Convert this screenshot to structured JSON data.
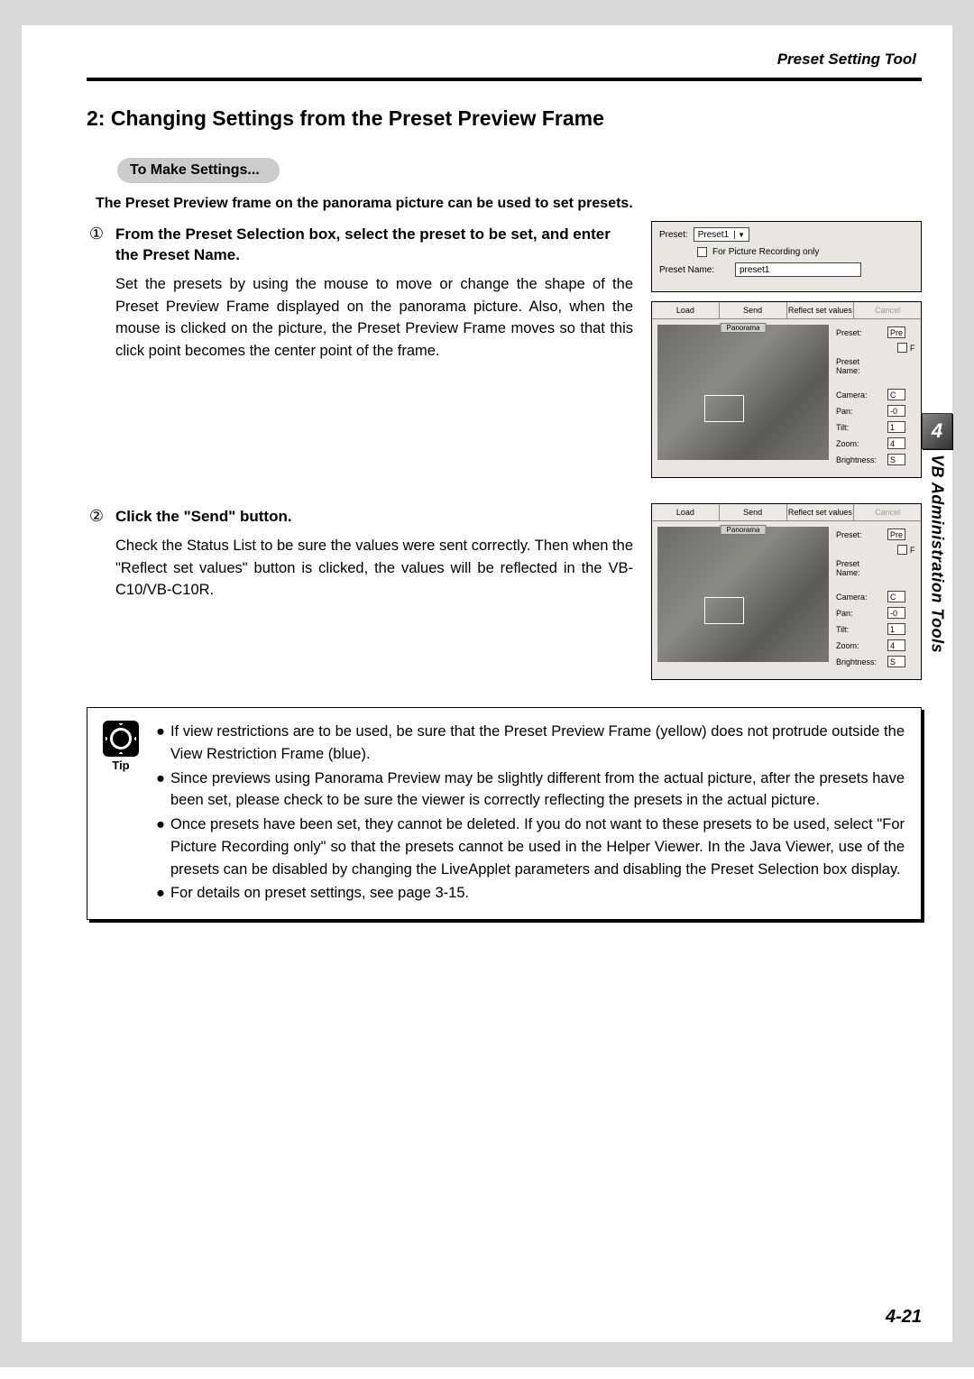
{
  "header": {
    "tool_title": "Preset Setting Tool"
  },
  "section": {
    "title": "2: Changing Settings from the Preset Preview Frame",
    "pill": "To Make Settings...",
    "lead": "The Preset Preview frame on the panorama picture can be used to set presets."
  },
  "step1": {
    "num": "①",
    "title": "From the Preset Selection box, select the preset to be set, and enter the Preset Name.",
    "body": "Set the presets by using the mouse to move or change the shape of the Preset Preview Frame displayed on the panorama picture. Also, when the mouse is clicked on the picture, the Preset Preview Frame moves so that this click point becomes the center point of the frame."
  },
  "step2": {
    "num": "②",
    "title": "Click the \"Send\" button.",
    "body": "Check the Status List to be sure the values were sent correctly. Then when the \"Reflect set values\" button is clicked, the values will be reflected in the VB-C10/VB-C10R."
  },
  "shot_top": {
    "preset_label": "Preset:",
    "preset_value": "Preset1",
    "recording_label": "For Picture Recording only",
    "name_label": "Preset Name:",
    "name_value": "preset1"
  },
  "shot_main": {
    "buttons": {
      "load": "Load",
      "send": "Send",
      "reflect": "Reflect set values",
      "cancel": "Cancel"
    },
    "pano_tab": "Panorama",
    "side": {
      "preset_l": "Preset:",
      "preset_v": "Pre",
      "for_rec": "F",
      "name_l": "Preset Name:",
      "camera_l": "Camera:",
      "camera_v": "C",
      "pan_l": "Pan:",
      "pan_v": "-0",
      "tilt_l": "Tilt:",
      "tilt_v": "1",
      "zoom_l": "Zoom:",
      "zoom_v": "4",
      "bright_l": "Brightness:",
      "bright_v": "S"
    }
  },
  "side_tab": {
    "num": "4",
    "text": "VB Administration Tools"
  },
  "tip": {
    "label": "Tip",
    "items": [
      "If view restrictions are to be used, be sure that the Preset Preview Frame (yellow) does not protrude outside the View Restriction Frame (blue).",
      "Since previews using Panorama Preview may be slightly different from the actual picture, after the presets have been set, please check to be sure the viewer is correctly reflecting the presets in the actual picture.",
      "Once presets have been set, they cannot be deleted. If you do not want to these presets to be used, select \"For Picture Recording only\" so that the presets cannot be used in the Helper Viewer. In the Java Viewer, use of the presets can be disabled by changing the LiveApplet parameters and disabling the Preset Selection box display.",
      "For details on preset settings, see page 3-15."
    ]
  },
  "page_number": "4-21"
}
